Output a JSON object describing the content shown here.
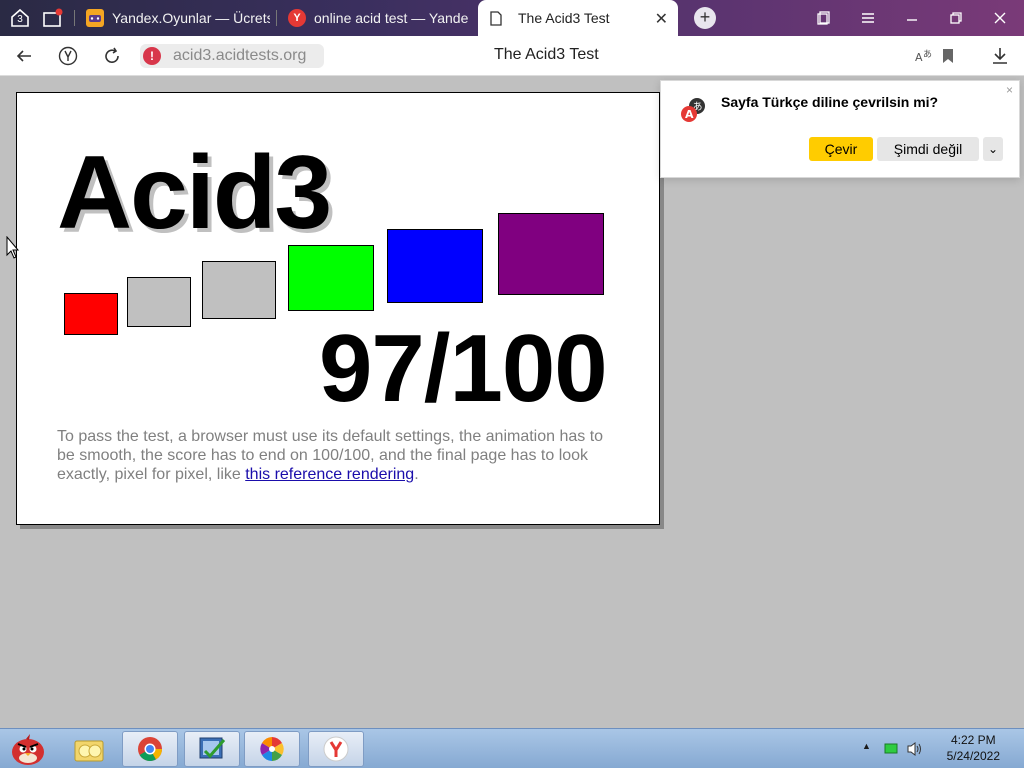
{
  "tabs": {
    "count_badge": "3",
    "items": [
      {
        "title": "Yandex.Oyunlar — Ücretsi",
        "fav_color": "#f5a623"
      },
      {
        "title": "online acid test — Yande",
        "fav_color": "#e53935",
        "fav_glyph": "Y"
      }
    ],
    "active": {
      "title": "The Acid3 Test",
      "close": "✕"
    },
    "new_tab": "+"
  },
  "toolbar": {
    "url": "acid3.acidtests.org",
    "warning_glyph": "!",
    "page_title": "The Acid3 Test"
  },
  "page": {
    "title": "Acid3",
    "score": "97/100",
    "desc_text": "To pass the test, a browser must use its default settings, the animation has to be smooth, the score has to end on 100/100, and the final page has to look exactly, pixel for pixel, like ",
    "link_text": "this reference rendering",
    "desc_end": ".",
    "box_colors": [
      "#ff0000",
      "#c0c0c0",
      "#c0c0c0",
      "#00ff00",
      "#0000ff",
      "#800080"
    ]
  },
  "translate_popup": {
    "question": "Sayfa Türkçe diline çevrilsin mi?",
    "translate_label": "Çevir",
    "not_now_label": "Şimdi değil",
    "dropdown_glyph": "⌄",
    "close_glyph": "×"
  },
  "taskbar": {
    "clock_time": "4:22 PM",
    "clock_date": "5/24/2022",
    "tray_arrow": "▲"
  }
}
